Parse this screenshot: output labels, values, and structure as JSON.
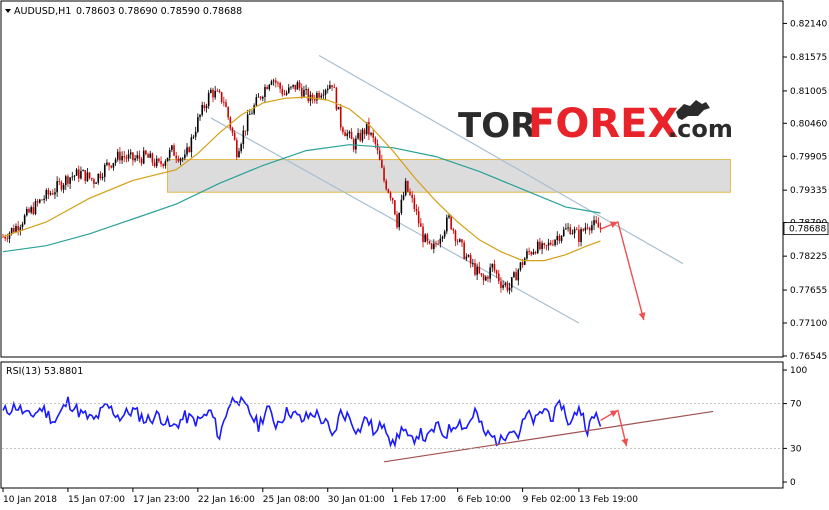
{
  "header": {
    "symbol": "AUDUSD,H1",
    "ohlc": "0.78603 0.78690 0.78590 0.78688"
  },
  "watermark": {
    "part1": "TOR",
    "part2": "FOREX",
    "part3": ".com",
    "accent": "#e8232a",
    "dark": "#2b2b2b"
  },
  "colors": {
    "bull": "#000000",
    "bear": "#cc0000",
    "ma_fast": "#d4a017",
    "ma_slow": "#2aa198",
    "channel": "#a9bfd0",
    "zone_fill": "#d6d6d6",
    "zone_border": "#e3b94a",
    "arrow": "#ef4f4f",
    "rsi": "#1a1aff",
    "rsi_trend": "#a05050"
  },
  "chart_data": [
    {
      "type": "candlestick",
      "symbol": "AUDUSD",
      "timeframe": "H1",
      "last_price": 0.78688,
      "last_price_label": "0.78688",
      "y_ticks": [
        0.8214,
        0.81575,
        0.81005,
        0.8046,
        0.79905,
        0.79335,
        0.7879,
        0.78225,
        0.77655,
        0.771,
        0.76545
      ],
      "y_tick_labels": [
        "0.82140",
        "0.81575",
        "0.81005",
        "0.80460",
        "0.79905",
        "0.79335",
        "0.78790",
        "0.78225",
        "0.77655",
        "0.77100",
        "0.76545"
      ],
      "ylim": [
        0.76545,
        0.8245
      ],
      "x_ticks": [
        "10 Jan 2018",
        "15 Jan 07:00",
        "17 Jan 23:00",
        "22 Jan 16:00",
        "25 Jan 08:00",
        "30 Jan 01:00",
        "1 Feb 17:00",
        "6 Feb 10:00",
        "9 Feb 02:00",
        "13 Feb 19:00"
      ],
      "series": [
        {
          "kind": "price_path",
          "points": [
            [
              0,
              0.7855
            ],
            [
              3,
              0.7872
            ],
            [
              6,
              0.7895
            ],
            [
              9,
              0.7918
            ],
            [
              12,
              0.7935
            ],
            [
              15,
              0.7955
            ],
            [
              18,
              0.7962
            ],
            [
              21,
              0.795
            ],
            [
              24,
              0.7975
            ],
            [
              27,
              0.7992
            ],
            [
              30,
              0.7985
            ],
            [
              33,
              0.799
            ],
            [
              36,
              0.7975
            ],
            [
              39,
              0.8
            ],
            [
              42,
              0.7985
            ],
            [
              45,
              0.805
            ],
            [
              48,
              0.81
            ],
            [
              51,
              0.8085
            ],
            [
              54,
              0.8
            ],
            [
              57,
              0.806
            ],
            [
              60,
              0.81
            ],
            [
              62,
              0.8125
            ],
            [
              65,
              0.8095
            ],
            [
              68,
              0.811
            ],
            [
              71,
              0.8085
            ],
            [
              74,
              0.8105
            ],
            [
              76,
              0.8115
            ],
            [
              78,
              0.8045
            ],
            [
              81,
              0.801
            ],
            [
              84,
              0.8038
            ],
            [
              86,
              0.801
            ],
            [
              88,
              0.795
            ],
            [
              90,
              0.792
            ],
            [
              91,
              0.788
            ],
            [
              93,
              0.794
            ],
            [
              95,
              0.7905
            ],
            [
              97,
              0.7855
            ],
            [
              99,
              0.7828
            ],
            [
              101,
              0.786
            ],
            [
              103,
              0.7885
            ],
            [
              105,
              0.785
            ],
            [
              107,
              0.782
            ],
            [
              109,
              0.78
            ],
            [
              111,
              0.778
            ],
            [
              113,
              0.7805
            ],
            [
              115,
              0.7778
            ],
            [
              117,
              0.777
            ],
            [
              119,
              0.78
            ],
            [
              121,
              0.7825
            ],
            [
              123,
              0.7838
            ],
            [
              125,
              0.7832
            ],
            [
              127,
              0.785
            ],
            [
              129,
              0.7862
            ],
            [
              131,
              0.787
            ],
            [
              133,
              0.7855
            ],
            [
              135,
              0.7878
            ],
            [
              137,
              0.7872
            ],
            [
              138,
              0.78688
            ]
          ]
        },
        {
          "kind": "moving_average_fast",
          "points": [
            [
              0,
              0.7855
            ],
            [
              10,
              0.788
            ],
            [
              20,
              0.792
            ],
            [
              30,
              0.795
            ],
            [
              40,
              0.7968
            ],
            [
              45,
              0.7995
            ],
            [
              50,
              0.803
            ],
            [
              55,
              0.806
            ],
            [
              60,
              0.808
            ],
            [
              65,
              0.8088
            ],
            [
              70,
              0.809
            ],
            [
              75,
              0.8085
            ],
            [
              80,
              0.807
            ],
            [
              85,
              0.804
            ],
            [
              90,
              0.8
            ],
            [
              95,
              0.7955
            ],
            [
              100,
              0.7915
            ],
            [
              105,
              0.788
            ],
            [
              110,
              0.785
            ],
            [
              115,
              0.783
            ],
            [
              120,
              0.7815
            ],
            [
              125,
              0.7815
            ],
            [
              130,
              0.7825
            ],
            [
              135,
              0.784
            ],
            [
              138,
              0.7848
            ]
          ]
        },
        {
          "kind": "moving_average_slow",
          "points": [
            [
              0,
              0.783
            ],
            [
              10,
              0.784
            ],
            [
              20,
              0.786
            ],
            [
              30,
              0.7885
            ],
            [
              40,
              0.791
            ],
            [
              50,
              0.7945
            ],
            [
              60,
              0.7975
            ],
            [
              70,
              0.8
            ],
            [
              80,
              0.801
            ],
            [
              90,
              0.8005
            ],
            [
              100,
              0.799
            ],
            [
              110,
              0.7965
            ],
            [
              120,
              0.7935
            ],
            [
              130,
              0.7905
            ],
            [
              138,
              0.7895
            ]
          ]
        },
        {
          "kind": "channel_upper",
          "points": [
            [
              73,
              0.816
            ],
            [
              157,
              0.781
            ]
          ]
        },
        {
          "kind": "channel_lower",
          "points": [
            [
              48,
              0.8055
            ],
            [
              133,
              0.771
            ]
          ]
        },
        {
          "kind": "resistance_zone",
          "range": [
            0.793,
            0.7985
          ],
          "x_range": [
            38,
            168
          ]
        },
        {
          "kind": "forecast_arrow",
          "points": [
            [
              138,
              0.7868
            ],
            [
              142,
              0.788
            ],
            [
              148,
              0.7715
            ]
          ]
        }
      ]
    },
    {
      "type": "line",
      "indicator": "RSI",
      "title": "RSI(13) 53.8801",
      "y_ticks": [
        0,
        30,
        70,
        100
      ],
      "ylim": [
        0,
        100
      ],
      "series": [
        {
          "kind": "rsi",
          "points": [
            [
              0,
              62
            ],
            [
              3,
              68
            ],
            [
              6,
              58
            ],
            [
              9,
              66
            ],
            [
              12,
              54
            ],
            [
              15,
              72
            ],
            [
              18,
              61
            ],
            [
              21,
              55
            ],
            [
              24,
              68
            ],
            [
              27,
              58
            ],
            [
              30,
              64
            ],
            [
              33,
              55
            ],
            [
              36,
              60
            ],
            [
              39,
              48
            ],
            [
              42,
              58
            ],
            [
              45,
              54
            ],
            [
              48,
              63
            ],
            [
              50,
              40
            ],
            [
              52,
              68
            ],
            [
              54,
              77
            ],
            [
              55,
              70
            ],
            [
              57,
              62
            ],
            [
              59,
              50
            ],
            [
              61,
              66
            ],
            [
              63,
              52
            ],
            [
              66,
              64
            ],
            [
              69,
              55
            ],
            [
              72,
              62
            ],
            [
              75,
              50
            ],
            [
              76,
              38
            ],
            [
              78,
              62
            ],
            [
              80,
              58
            ],
            [
              82,
              45
            ],
            [
              84,
              58
            ],
            [
              86,
              42
            ],
            [
              88,
              55
            ],
            [
              90,
              32
            ],
            [
              92,
              48
            ],
            [
              94,
              36
            ],
            [
              96,
              44
            ],
            [
              98,
              38
            ],
            [
              100,
              50
            ],
            [
              102,
              42
            ],
            [
              105,
              55
            ],
            [
              107,
              48
            ],
            [
              109,
              64
            ],
            [
              111,
              44
            ],
            [
              113,
              40
            ],
            [
              115,
              36
            ],
            [
              117,
              50
            ],
            [
              119,
              42
            ],
            [
              121,
              60
            ],
            [
              123,
              54
            ],
            [
              125,
              66
            ],
            [
              127,
              58
            ],
            [
              129,
              70
            ],
            [
              131,
              50
            ],
            [
              133,
              68
            ],
            [
              135,
              48
            ],
            [
              137,
              60
            ],
            [
              138,
              53.88
            ]
          ]
        },
        {
          "kind": "rsi_trendline",
          "points": [
            [
              88,
              18
            ],
            [
              164,
              63
            ]
          ]
        },
        {
          "kind": "forecast_arrow",
          "points": [
            [
              138,
              55
            ],
            [
              142,
              64
            ],
            [
              144,
              32
            ]
          ]
        }
      ]
    }
  ]
}
